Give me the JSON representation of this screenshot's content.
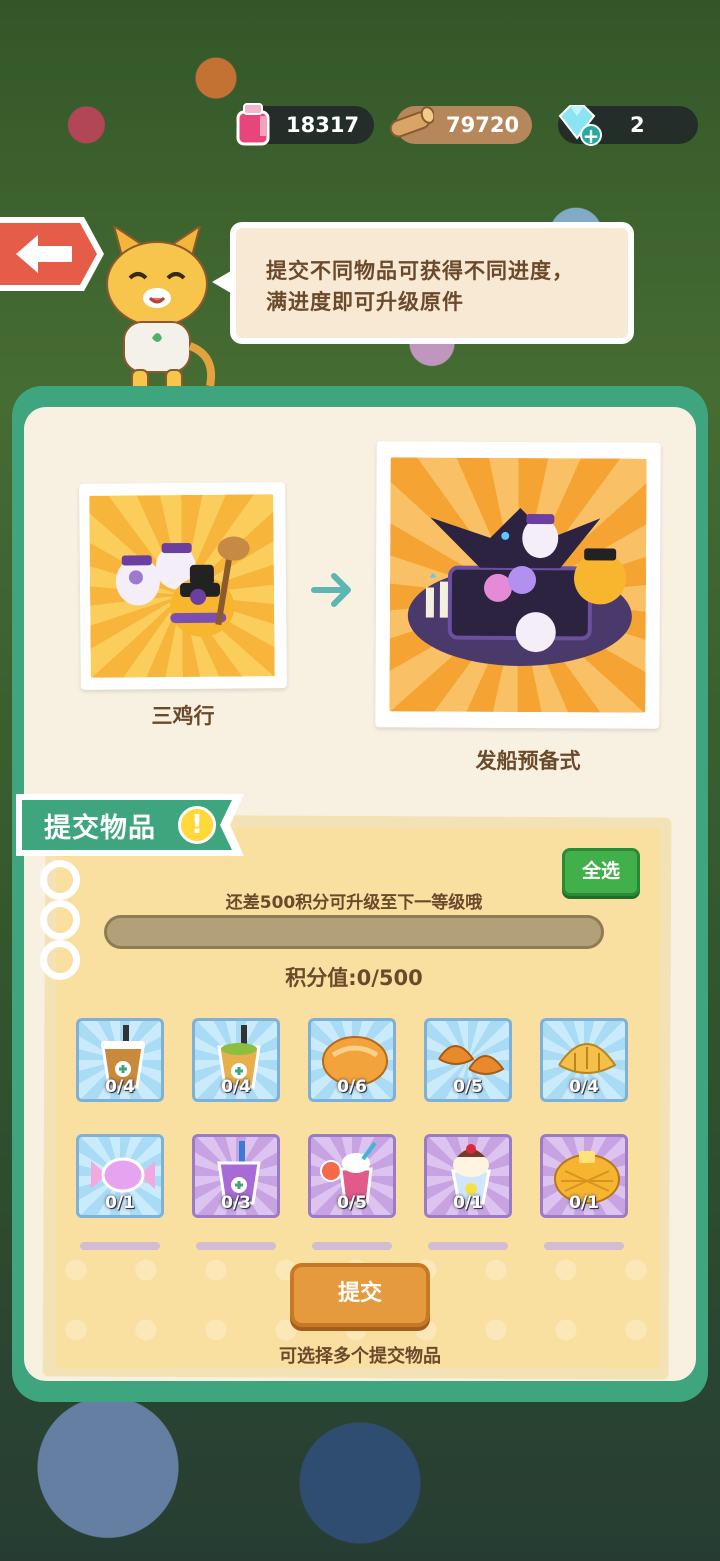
{
  "currency": {
    "ink": "18317",
    "wood": "79720",
    "gems": "2"
  },
  "tip": {
    "line1": "提交不同物品可获得不同进度，",
    "line2": "满进度即可升级原件"
  },
  "upgrade": {
    "current_name": "三鸡行",
    "next_name": "发船预备式"
  },
  "submit_section": {
    "title": "提交物品",
    "select_all": "全选",
    "hint": "还差500积分可升级至下一等级哦",
    "progress": 0.0,
    "points": "积分值:0/500",
    "submit": "提交",
    "footer": "可选择多个提交物品"
  },
  "items": [
    {
      "name": "bubble-tea-icon",
      "count": "0/4"
    },
    {
      "name": "green-milk-tea-icon",
      "count": "0/4"
    },
    {
      "name": "bread-roll-icon",
      "count": "0/6"
    },
    {
      "name": "croissants-icon",
      "count": "0/5"
    },
    {
      "name": "croissant-icon",
      "count": "0/4"
    },
    {
      "name": "candy-icon",
      "count": "0/1"
    },
    {
      "name": "purple-bubble-tea-icon",
      "count": "0/3"
    },
    {
      "name": "fruit-smoothie-icon",
      "count": "0/5"
    },
    {
      "name": "sundae-icon",
      "count": "0/1"
    },
    {
      "name": "pineapple-bun-icon",
      "count": "0/1"
    }
  ]
}
